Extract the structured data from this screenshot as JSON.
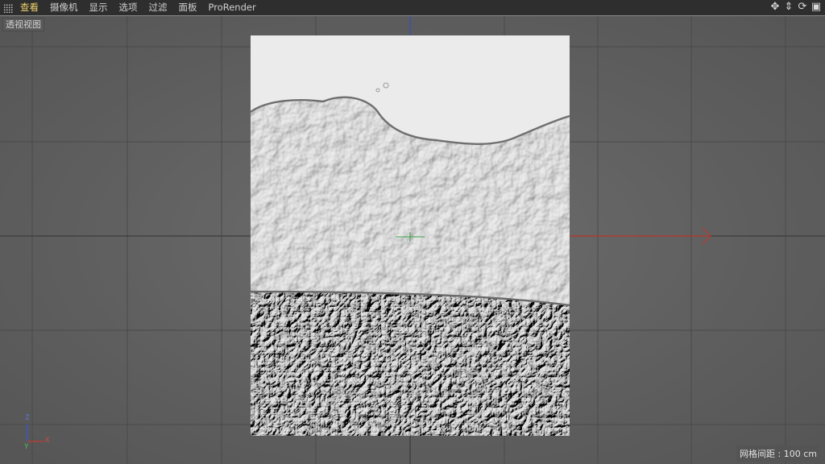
{
  "menubar": {
    "items": [
      {
        "label": "查看",
        "active": true
      },
      {
        "label": "摄像机",
        "active": false
      },
      {
        "label": "显示",
        "active": false
      },
      {
        "label": "选项",
        "active": false
      },
      {
        "label": "过滤",
        "active": false
      },
      {
        "label": "面板",
        "active": false
      },
      {
        "label": "ProRender",
        "active": false
      }
    ],
    "nav_icons": [
      "move-view-icon",
      "zoom-view-icon",
      "rotate-view-icon",
      "toggle-layout-icon"
    ]
  },
  "viewport": {
    "label": "透视视图",
    "grid_spacing": "网格间距 : 100 cm",
    "axis_labels": {
      "z": "Z",
      "x": "X",
      "y": "Y"
    }
  },
  "colors": {
    "accent_menu": "#f2d36b",
    "x_axis": "#c23a2e",
    "y_axis": "#3aa14a",
    "z_axis": "#3a57c8"
  }
}
